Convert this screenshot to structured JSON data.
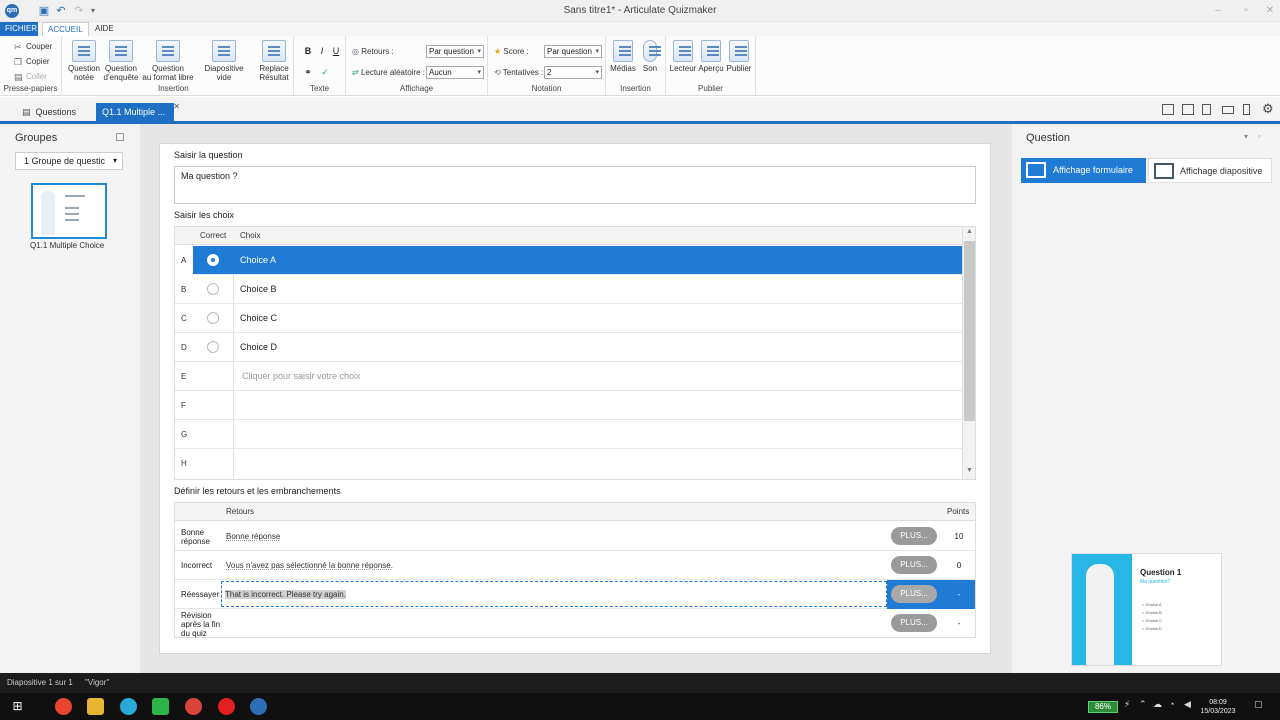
{
  "window": {
    "title": "Sans titre1* - Articulate Quizmaker",
    "app_logo": "qm"
  },
  "ribbon_tabs": [
    "FICHIER",
    "ACCUEIL",
    "AIDE"
  ],
  "ribbon": {
    "clipboard": {
      "cut": "Couper",
      "copy": "Copier",
      "paste": "Coller",
      "label": "Presse-papiers"
    },
    "insertion": {
      "graded_l1": "Question",
      "graded_l2": "notée",
      "survey_l1": "Question",
      "survey_l2": "d'enquête",
      "freeform_l1": "Question",
      "freeform_l2": "au format libre",
      "label": "Insertion"
    },
    "slide": {
      "blank": "Diapositive vide",
      "replace_l1": "Replace",
      "replace_l2": "Résultat"
    },
    "text": {
      "bold": "B",
      "italic": "I",
      "underline": "U",
      "label": "Texte"
    },
    "display": {
      "feedback_label": "Retours :",
      "feedback_value": "Par question",
      "shuffle_label": "Lecture aléatoire :",
      "shuffle_value": "Aucun",
      "label": "Affichage"
    },
    "scoring": {
      "score_label": "Score :",
      "score_value": "Par question",
      "attempts_label": "Tentatives :",
      "attempts_value": "2",
      "label": "Notation"
    },
    "media": {
      "media": "Médias",
      "sound": "Son",
      "label": "Insertion"
    },
    "publish": {
      "player": "Lecteur",
      "preview": "Aperçu",
      "publish": "Publier",
      "label": "Publier"
    }
  },
  "doc_tabs": {
    "questions": "Questions",
    "current": "Q1.1 Multiple ..."
  },
  "left_panel": {
    "title": "Groupes",
    "group_select": "1 Groupe de questic",
    "thumb_label": "Q1.1 Multiple Choice"
  },
  "editor": {
    "question_heading": "Saisir la question",
    "question_text": "Ma question ?",
    "choices_heading": "Saisir les choix",
    "col_correct": "Correct",
    "col_choice": "Choix",
    "choices": [
      {
        "letter": "A",
        "text": "Choice A",
        "correct": true
      },
      {
        "letter": "B",
        "text": "Choice B",
        "correct": false
      },
      {
        "letter": "C",
        "text": "Choice C",
        "correct": false
      },
      {
        "letter": "D",
        "text": "Choice D",
        "correct": false
      },
      {
        "letter": "E",
        "text": "Cliquer pour saisir votre choix"
      },
      {
        "letter": "F",
        "text": ""
      },
      {
        "letter": "G",
        "text": ""
      },
      {
        "letter": "H",
        "text": ""
      }
    ],
    "feedback_heading": "Définir les retours et les embranchements",
    "col_feedback": "Retours",
    "col_points": "Points",
    "feedback": [
      {
        "label": "Bonne réponse",
        "text": "Bonne réponse",
        "more": "PLUS...",
        "points": "10"
      },
      {
        "label": "Incorrect",
        "text": "Vous n'avez pas sélectionné la bonne réponse.",
        "more": "PLUS...",
        "points": "0"
      },
      {
        "label": "Réessayer",
        "text": "That is incorrect. Please try again.",
        "more": "PLUS...",
        "points": "-"
      },
      {
        "label": "Révision après la fin du quiz",
        "text": "",
        "more": "PLUS...",
        "points": "-"
      }
    ]
  },
  "right_panel": {
    "title": "Question",
    "form_view": "Affichage formulaire",
    "slide_view": "Affichage diapositive",
    "preview_title": "Question 1",
    "preview_sub": "Ma question?",
    "preview_options": [
      "Choice A",
      "Choice B",
      "Choice C",
      "Choice D"
    ]
  },
  "status": {
    "slide": "Diapositive 1 sur 1",
    "theme": "\"Vigor\""
  },
  "taskbar": {
    "battery": "86%",
    "time": "08:09",
    "date": "15/03/2023"
  },
  "colors": {
    "accent": "#1f7bd4",
    "panel": "#f3f3f3",
    "taskbar": "#101010"
  }
}
